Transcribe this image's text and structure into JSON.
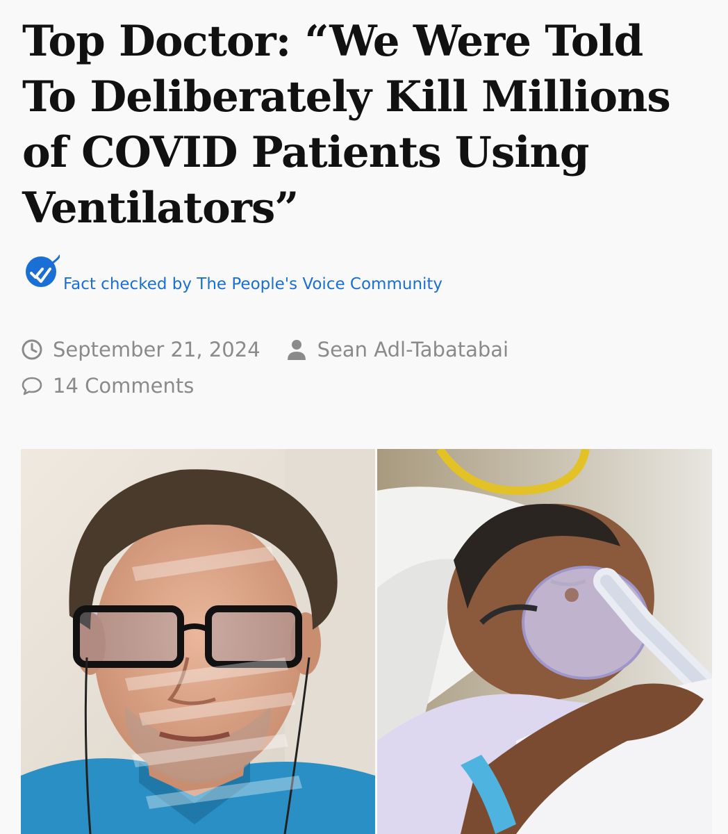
{
  "article": {
    "headline": "Top Doctor: “We Were Told To Deliberately Kill Millions of COVID Patients Using Ventilators”",
    "fact_check": {
      "text": "Fact checked by The People's Voice Community",
      "icon": "double-check-badge-icon",
      "color": "#1a6fd6"
    },
    "meta": {
      "date": "September 21, 2024",
      "date_icon": "clock-icon",
      "author": "Sean Adl-Tabatabai",
      "author_icon": "user-icon",
      "comments": "14 Comments",
      "comments_icon": "speech-bubble-icon"
    },
    "images": [
      {
        "name": "doctor-video-call-photo"
      },
      {
        "name": "patient-oxygen-mask-photo"
      }
    ]
  },
  "colors": {
    "background": "#f9f9f9",
    "headline": "#111111",
    "meta": "#8a8a8a",
    "link": "#1a6fd6"
  }
}
